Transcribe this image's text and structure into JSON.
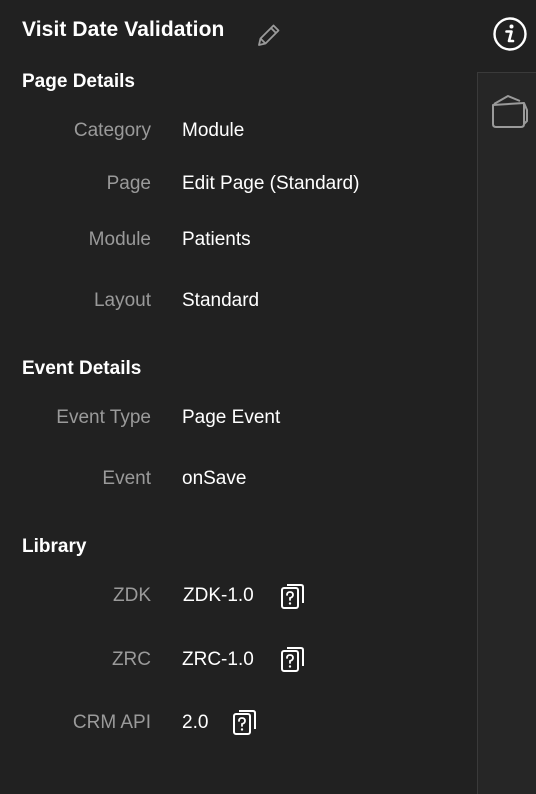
{
  "header": {
    "title": "Visit Date Validation",
    "edit_icon": "pencil-icon",
    "info_icon": "info-icon"
  },
  "rail": {
    "icon": "wallet-icon"
  },
  "page_details": {
    "heading": "Page Details",
    "rows": [
      {
        "label": "Category",
        "value": "Module"
      },
      {
        "label": "Page",
        "value": "Edit Page (Standard)"
      },
      {
        "label": "Module",
        "value": "Patients"
      },
      {
        "label": "Layout",
        "value": "Standard"
      }
    ]
  },
  "event_details": {
    "heading": "Event Details",
    "rows": [
      {
        "label": "Event Type",
        "value": "Page Event"
      },
      {
        "label": "Event",
        "value": "onSave"
      }
    ]
  },
  "library": {
    "heading": "Library",
    "rows": [
      {
        "label": "ZDK",
        "value": "ZDK-1.0",
        "icon": "help-doc-icon"
      },
      {
        "label": "ZRC",
        "value": "ZRC-1.0",
        "icon": "help-doc-icon"
      },
      {
        "label": "CRM API",
        "value": "2.0",
        "icon": "help-doc-icon"
      }
    ]
  },
  "colors": {
    "background": "#212121",
    "label": "#9a9a9a",
    "value": "#ffffff"
  }
}
